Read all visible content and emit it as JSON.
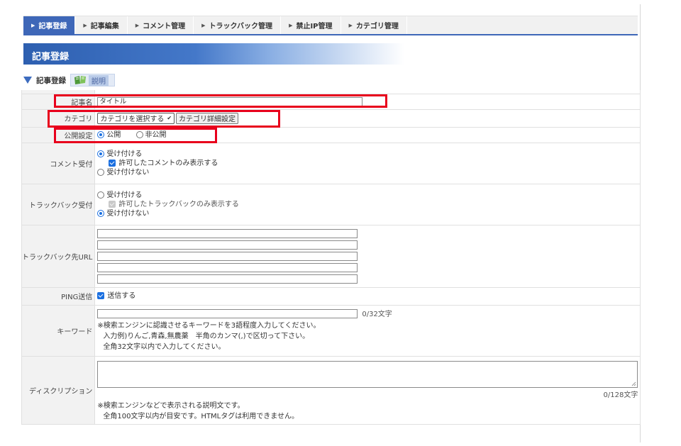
{
  "tabs": [
    {
      "label": "記事登録",
      "active": true
    },
    {
      "label": "記事編集",
      "active": false
    },
    {
      "label": "コメント管理",
      "active": false
    },
    {
      "label": "トラックバック管理",
      "active": false
    },
    {
      "label": "禁止IP管理",
      "active": false
    },
    {
      "label": "カテゴリ管理",
      "active": false
    }
  ],
  "page_title": "記事登録",
  "section": {
    "label": "記事登録",
    "help_label": "説明"
  },
  "form": {
    "title_label": "記事名",
    "title_value": "タイトル",
    "category_label": "カテゴリ",
    "category_selected": "カテゴリを選択する",
    "category_detail_button": "カテゴリ詳細設定",
    "public_label": "公開設定",
    "public_option_on": "公開",
    "public_option_off": "非公開",
    "comment_label": "コメント受付",
    "comment_accept": "受け付ける",
    "comment_approved_only": "許可したコメントのみ表示する",
    "comment_reject": "受け付けない",
    "trackback_label": "トラックバック受付",
    "trackback_accept": "受け付ける",
    "trackback_approved_only": "許可したトラックバックのみ表示する",
    "trackback_reject": "受け付けない",
    "trackback_url_label": "トラックバック先URL",
    "ping_label": "PING送信",
    "ping_option": "送信する",
    "keyword_label": "キーワード",
    "keyword_counter": "0/32文字",
    "keyword_note1": "※検索エンジンに認識させるキーワードを3語程度入力してください。",
    "keyword_note2": "入力例)りんご,青森,無農薬　半角のカンマ(,)で区切って下さい。",
    "keyword_note3": "全角32文字以内で入力してください。",
    "description_label": "ディスクリプション",
    "description_counter": "0/128文字",
    "description_note1": "※検索エンジンなどで表示される説明文です。",
    "description_note2": "全角100文字以内が目安です。HTMLタグは利用できません。"
  },
  "colors": {
    "accent": "#3e67b8",
    "highlight": "#e8001c",
    "control": "#1a6fe0"
  }
}
